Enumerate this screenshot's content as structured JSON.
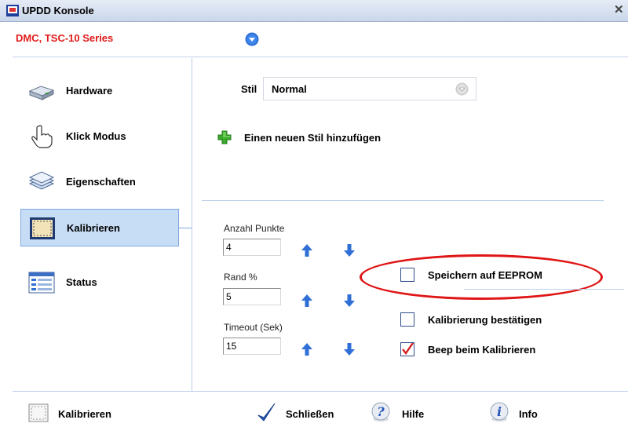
{
  "window": {
    "title": "UPDD Konsole",
    "close_glyph": "✕"
  },
  "device": {
    "name": "DMC, TSC-10 Series"
  },
  "sidebar": {
    "items": [
      {
        "label": "Hardware",
        "icon": "hardware-icon"
      },
      {
        "label": "Klick Modus",
        "icon": "hand-pointer-icon"
      },
      {
        "label": "Eigenschaften",
        "icon": "layers-icon"
      },
      {
        "label": "Kalibrieren",
        "icon": "calibrate-icon",
        "active": true
      },
      {
        "label": "Status",
        "icon": "status-icon"
      }
    ]
  },
  "style": {
    "label": "Stil",
    "value": "Normal",
    "add_label": "Einen neuen Stil hinzufügen"
  },
  "calibration": {
    "points": {
      "label": "Anzahl Punkte",
      "value": "4"
    },
    "margin": {
      "label": "Rand %",
      "value": "5"
    },
    "timeout": {
      "label": "Timeout (Sek)",
      "value": "15"
    }
  },
  "options": [
    {
      "label": "Speichern auf EEPROM",
      "checked": false
    },
    {
      "label": "Kalibrierung bestätigen",
      "checked": false
    },
    {
      "label": "Beep beim Kalibrieren",
      "checked": true
    }
  ],
  "footer": {
    "calibrate_label": "Kalibrieren",
    "close_label": "Schließen",
    "help_label": "Hilfe",
    "info_label": "Info"
  },
  "colors": {
    "device_text": "#e11a1a",
    "accent": "#2f6fd6",
    "active_bg": "#c7ddf6",
    "highlight": "#e01515"
  }
}
